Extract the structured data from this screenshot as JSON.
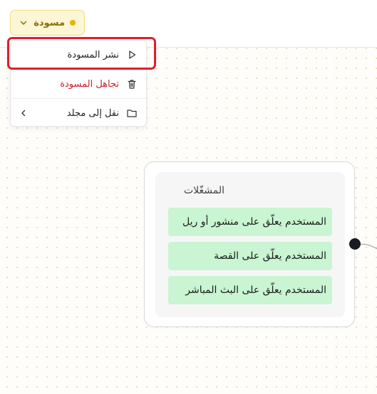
{
  "status_pill": {
    "label": "مسودة",
    "dot_color": "#e8b400",
    "icon": "chevron-down-icon"
  },
  "menu": {
    "items": [
      {
        "label": "نشر المسودة",
        "icon": "play-icon",
        "highlighted": true
      },
      {
        "label": "تجاهل المسودة",
        "icon": "trash-icon",
        "color": "#d11a2a"
      },
      {
        "label": "نقل إلى مجلد",
        "icon": "folder-icon",
        "trailing_icon": "chevron-left-icon"
      }
    ],
    "highlight_color": "#e11d2b"
  },
  "node": {
    "title": "المشغّلات",
    "triggers": [
      {
        "label": "المستخدم يعلّق على منشور أو ريل"
      },
      {
        "label": "المستخدم يعلّق على القصة"
      },
      {
        "label": "المستخدم يعلّق على البث المباشر"
      }
    ],
    "trigger_bg": "#c9f5d2"
  }
}
